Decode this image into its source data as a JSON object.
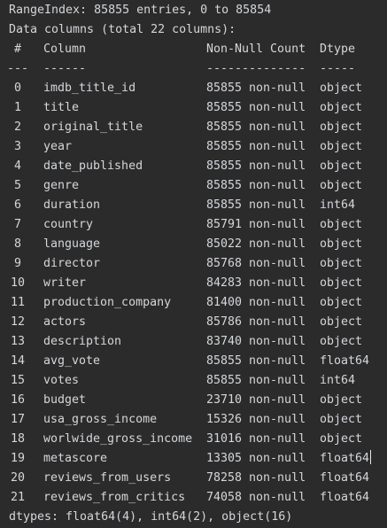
{
  "console": {
    "range_index": "RangeIndex: 85855 entries, 0 to 85854",
    "data_columns": "Data columns (total 22 columns):",
    "header": {
      "idx": "#",
      "column": "Column",
      "count": "Non-Null Count",
      "dtype": "Dtype"
    },
    "separator": {
      "idx": "---",
      "column": "------",
      "count": "--------------",
      "dtype": "-----"
    },
    "rows": [
      {
        "idx": "0",
        "column": "imdb_title_id",
        "count": "85855 non-null",
        "dtype": "object"
      },
      {
        "idx": "1",
        "column": "title",
        "count": "85855 non-null",
        "dtype": "object"
      },
      {
        "idx": "2",
        "column": "original_title",
        "count": "85855 non-null",
        "dtype": "object"
      },
      {
        "idx": "3",
        "column": "year",
        "count": "85855 non-null",
        "dtype": "object"
      },
      {
        "idx": "4",
        "column": "date_published",
        "count": "85855 non-null",
        "dtype": "object"
      },
      {
        "idx": "5",
        "column": "genre",
        "count": "85855 non-null",
        "dtype": "object"
      },
      {
        "idx": "6",
        "column": "duration",
        "count": "85855 non-null",
        "dtype": "int64"
      },
      {
        "idx": "7",
        "column": "country",
        "count": "85791 non-null",
        "dtype": "object"
      },
      {
        "idx": "8",
        "column": "language",
        "count": "85022 non-null",
        "dtype": "object"
      },
      {
        "idx": "9",
        "column": "director",
        "count": "85768 non-null",
        "dtype": "object"
      },
      {
        "idx": "10",
        "column": "writer",
        "count": "84283 non-null",
        "dtype": "object"
      },
      {
        "idx": "11",
        "column": "production_company",
        "count": "81400 non-null",
        "dtype": "object"
      },
      {
        "idx": "12",
        "column": "actors",
        "count": "85786 non-null",
        "dtype": "object"
      },
      {
        "idx": "13",
        "column": "description",
        "count": "83740 non-null",
        "dtype": "object"
      },
      {
        "idx": "14",
        "column": "avg_vote",
        "count": "85855 non-null",
        "dtype": "float64"
      },
      {
        "idx": "15",
        "column": "votes",
        "count": "85855 non-null",
        "dtype": "int64"
      },
      {
        "idx": "16",
        "column": "budget",
        "count": "23710 non-null",
        "dtype": "object"
      },
      {
        "idx": "17",
        "column": "usa_gross_income",
        "count": "15326 non-null",
        "dtype": "object"
      },
      {
        "idx": "18",
        "column": "worlwide_gross_income",
        "count": "31016 non-null",
        "dtype": "object"
      },
      {
        "idx": "19",
        "column": "metascore",
        "count": "13305 non-null",
        "dtype": "float64"
      },
      {
        "idx": "20",
        "column": "reviews_from_users",
        "count": "78258 non-null",
        "dtype": "float64"
      },
      {
        "idx": "21",
        "column": "reviews_from_critics",
        "count": "74058 non-null",
        "dtype": "float64"
      }
    ],
    "dtypes_summary": "dtypes: float64(4), int64(2), object(16)"
  }
}
